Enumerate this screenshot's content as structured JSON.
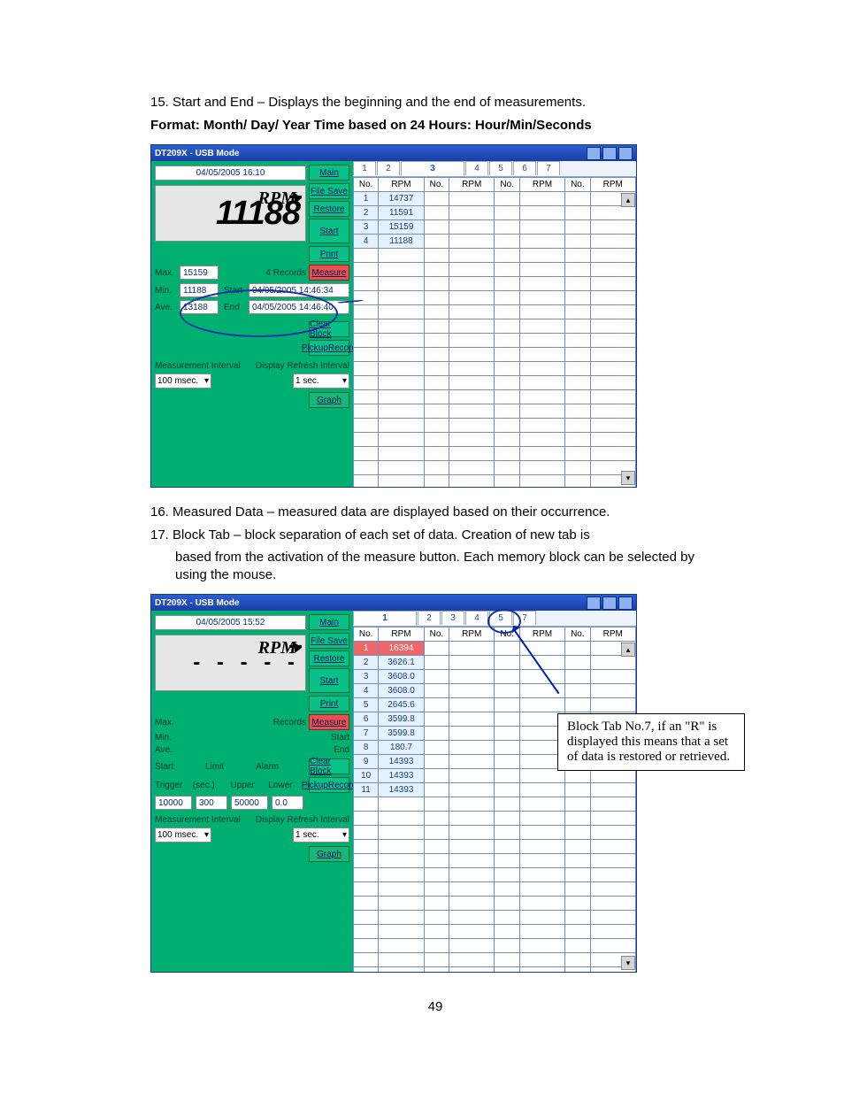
{
  "text": {
    "item15": "15. Start and End – Displays the beginning and the end of measurements.",
    "format_line": "Format: Month/ Day/ Year   Time based on 24 Hours:  Hour/Min/Seconds",
    "item16": "16. Measured Data – measured data are displayed based on their occurrence.",
    "item17_a": "17. Block Tab – block separation of each set of data.  Creation of new tab is",
    "item17_b": "based from the activation of the measure button.   Each memory block can be selected by using the mouse.",
    "callout2": "Block Tab No.7, if an \"R\" is displayed this means that a set of data is restored or retrieved.",
    "page": "49"
  },
  "fig1": {
    "title": "DT209X - USB Mode",
    "datetime": "04/05/2005 16:10",
    "lcd_unit": "RPM",
    "lcd_value": "11188",
    "stats": {
      "max_lbl": "Max.",
      "max": "15159",
      "records_lbl": "Records",
      "records": "4",
      "min_lbl": "Min.",
      "min": "11188",
      "start_lbl": "Start",
      "start": "04/05/2005 14:46:34",
      "ave_lbl": "Ave.",
      "ave": "13188",
      "end_lbl": "End",
      "end": "04/05/2005 14:46:40"
    },
    "buttons": {
      "main": "Main",
      "filesave": "File Save",
      "restore": "Restore",
      "start": "Start",
      "print": "Print",
      "measure": "Measure",
      "clearblock": "Clear Block",
      "pickup": "PickupRecord",
      "graph": "Graph"
    },
    "interval_lbl": "Measurement Interval",
    "meas_int": "100 msec.",
    "refresh_lbl": "Display Refresh Interval",
    "refresh": "1 sec.",
    "tabs": [
      "1",
      "2",
      "3",
      "4",
      "5",
      "6",
      "7"
    ],
    "headers": [
      "No.",
      "RPM",
      "No.",
      "RPM",
      "No.",
      "RPM",
      "No.",
      "RPM"
    ],
    "rows": [
      [
        "1",
        "14737"
      ],
      [
        "2",
        "11591"
      ],
      [
        "3",
        "15159"
      ],
      [
        "4",
        "11188"
      ]
    ]
  },
  "fig2": {
    "title": "DT209X - USB Mode",
    "datetime": "04/05/2005 15:52",
    "lcd_unit": "RPM",
    "stats": {
      "max_lbl": "Max.",
      "records_lbl": "Records",
      "min_lbl": "Min.",
      "start_lbl": "Start",
      "ave_lbl": "Ave.",
      "end_lbl": "End"
    },
    "trigger": {
      "start": "Start",
      "limit": "Limit",
      "alarm": "Alarm",
      "trigger": "Trigger",
      "sec": "(sec.)",
      "upper": "Upper",
      "lower": "Lower",
      "v_trigger": "10000",
      "v_sec": "300",
      "v_upper": "50000",
      "v_lower": "0.0"
    },
    "buttons": {
      "main": "Main",
      "filesave": "File Save",
      "restore": "Restore",
      "start": "Start",
      "print": "Print",
      "measure": "Measure",
      "clearblock": "Clear Block",
      "pickup": "PickupRecord",
      "graph": "Graph"
    },
    "interval_lbl": "Measurement Interval",
    "meas_int": "100 msec.",
    "refresh_lbl": "Display Refresh Interval",
    "refresh": "1 sec.",
    "tabs": [
      "1",
      "2",
      "3",
      "4",
      "5",
      "7"
    ],
    "headers": [
      "No.",
      "RPM",
      "No.",
      "RPM",
      "No.",
      "RPM",
      "No.",
      "RPM"
    ],
    "rows": [
      [
        "1",
        "16394"
      ],
      [
        "2",
        "3626.1"
      ],
      [
        "3",
        "3608.0"
      ],
      [
        "4",
        "3608.0"
      ],
      [
        "5",
        "2645.6"
      ],
      [
        "6",
        "3599.8"
      ],
      [
        "7",
        "3599.8"
      ],
      [
        "8",
        "180.7"
      ],
      [
        "9",
        "14393"
      ],
      [
        "10",
        "14393"
      ],
      [
        "11",
        "14393"
      ]
    ]
  }
}
